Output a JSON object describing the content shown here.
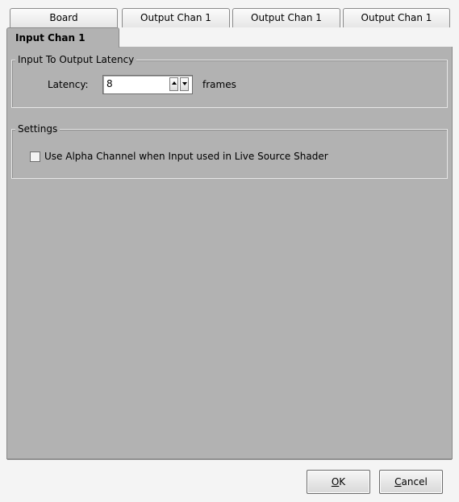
{
  "tabs": [
    {
      "label": "Board"
    },
    {
      "label": "Output Chan 1"
    },
    {
      "label": "Output Chan 1"
    },
    {
      "label": "Output Chan 1"
    },
    {
      "label": "Input Chan 1"
    }
  ],
  "latency_group": {
    "title": "Input To Output Latency",
    "label": "Latency:",
    "value": "8",
    "unit": "frames"
  },
  "settings_group": {
    "title": "Settings",
    "checkbox_label": "Use Alpha Channel when Input used in Live Source Shader",
    "checked": false
  },
  "buttons": {
    "ok_mnemonic": "O",
    "ok_rest": "K",
    "cancel_mnemonic": "C",
    "cancel_rest": "ancel"
  },
  "colors": {
    "panel": "#b2b2b2",
    "dialog_bg": "#f4f4f4"
  }
}
